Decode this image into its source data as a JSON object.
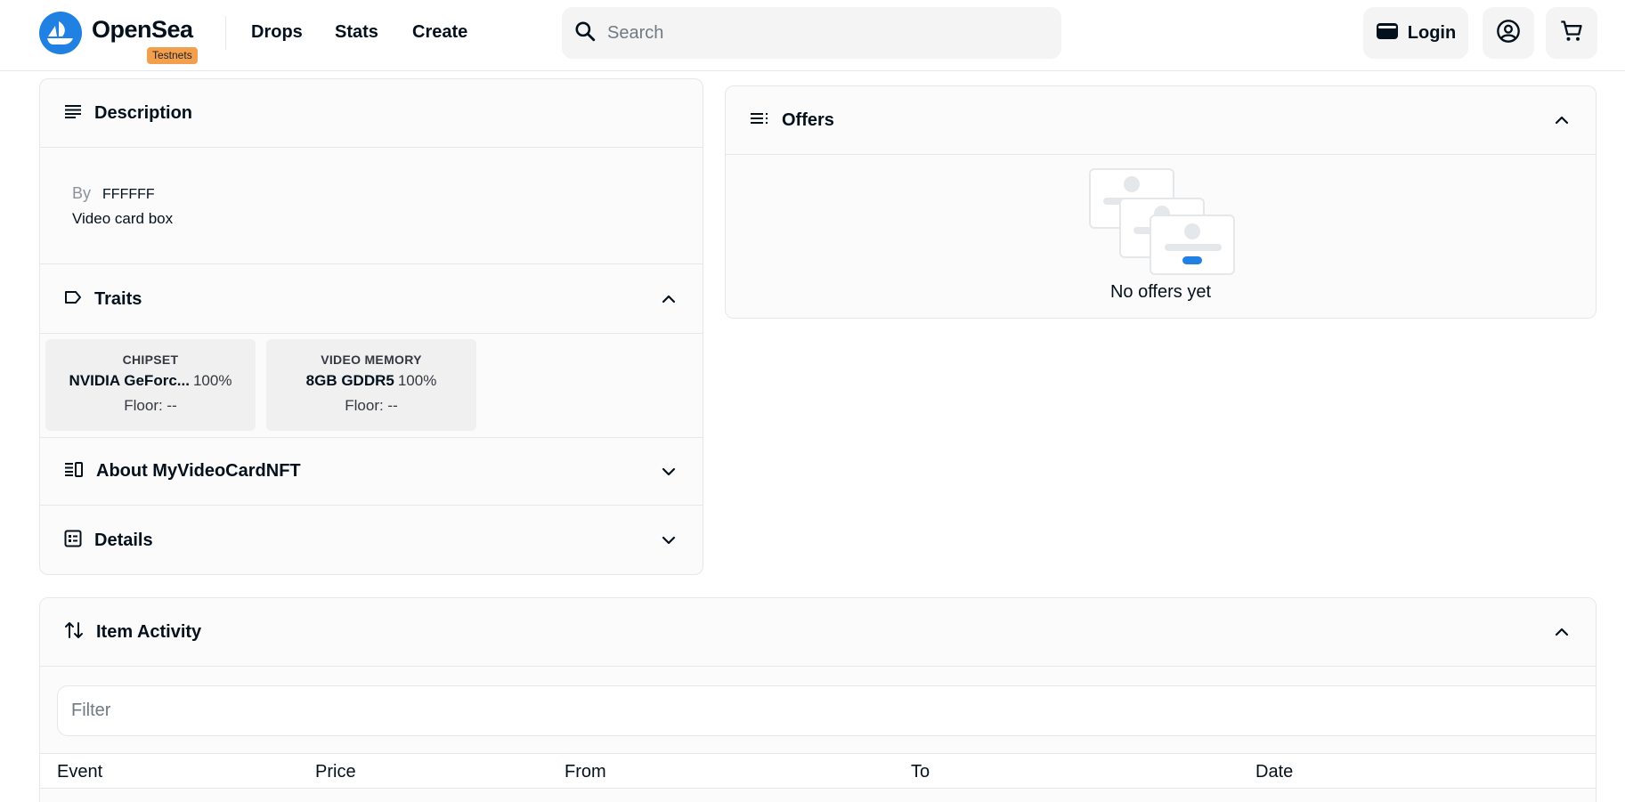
{
  "header": {
    "brand": "OpenSea",
    "badge": "Testnets",
    "nav": [
      "Drops",
      "Stats",
      "Create"
    ],
    "search_placeholder": "Search",
    "login_label": "Login",
    "accent": "#2081e2"
  },
  "description": {
    "title": "Description",
    "by_label": "By",
    "creator": "FFFFFF",
    "text": "Video card box"
  },
  "traits": {
    "title": "Traits",
    "items": [
      {
        "type": "CHIPSET",
        "value": "NVIDIA GeForc...",
        "percent": "100%",
        "floor": "Floor: --"
      },
      {
        "type": "VIDEO MEMORY",
        "value": "8GB GDDR5",
        "percent": "100%",
        "floor": "Floor: --"
      }
    ]
  },
  "about": {
    "title": "About MyVideoCardNFT"
  },
  "details": {
    "title": "Details"
  },
  "offers": {
    "title": "Offers",
    "empty_text": "No offers yet"
  },
  "activity": {
    "title": "Item Activity",
    "filter_label": "Filter",
    "columns": [
      "Event",
      "Price",
      "From",
      "To",
      "Date"
    ]
  }
}
